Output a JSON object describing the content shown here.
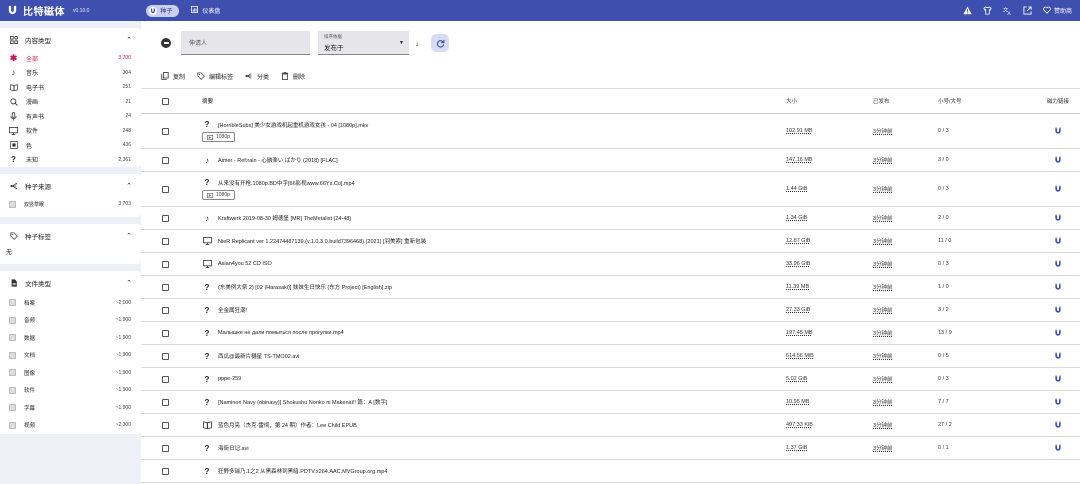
{
  "app": {
    "title": "比特磁体",
    "version": "v0.10.0"
  },
  "nav": {
    "torrents_tab": "种子",
    "dashboard_tab": "仪表盘",
    "donate": "赞助商"
  },
  "colors": {
    "primary": "#3f4fb0",
    "active": "#c2185b"
  },
  "sidebar": {
    "content_type": {
      "title": "内容类型",
      "items": [
        {
          "label": "全部",
          "count": "3,700",
          "icon": "asterisk-icon",
          "active": true
        },
        {
          "label": "音乐",
          "count": "304",
          "icon": "music-note-icon"
        },
        {
          "label": "电子书",
          "count": "251",
          "icon": "ebook-icon"
        },
        {
          "label": "漫画",
          "count": "21",
          "icon": "comic-icon"
        },
        {
          "label": "有声书",
          "count": "24",
          "icon": "microphone-icon"
        },
        {
          "label": "软件",
          "count": "248",
          "icon": "monitor-icon"
        },
        {
          "label": "色",
          "count": "436",
          "icon": "xxx-icon"
        },
        {
          "label": "未知",
          "count": "2,361",
          "icon": "question-icon"
        }
      ]
    },
    "torrent_source": {
      "title": "种子来源",
      "items": [
        {
          "label": "双竖草眠",
          "count": "3,703"
        }
      ]
    },
    "torrent_tags": {
      "title": "种子标签",
      "empty_text": "无"
    },
    "file_type": {
      "title": "文件类型",
      "items": [
        {
          "label": "档案",
          "count": "~2,000"
        },
        {
          "label": "音频",
          "count": "~1,900"
        },
        {
          "label": "数据",
          "count": "~1,900"
        },
        {
          "label": "文档",
          "count": "~1,900"
        },
        {
          "label": "图像",
          "count": "~1,900"
        },
        {
          "label": "软件",
          "count": "~1,900"
        },
        {
          "label": "字幕",
          "count": "~1,900"
        },
        {
          "label": "视频",
          "count": "~2,300"
        }
      ]
    }
  },
  "filters": {
    "search_placeholder": "伸请人",
    "sort_label": "排序依据",
    "sort_value": "发布于"
  },
  "toolbar": {
    "copy": "复制",
    "edit_tags": "编辑标签",
    "classify": "分类",
    "delete": "删除"
  },
  "table": {
    "headers": {
      "name": "摘要",
      "size": "大小",
      "published": "已发布",
      "peers": "小号/大号",
      "magnet": "磁力链接"
    },
    "rows": [
      {
        "icon": "question",
        "name": "[HorribleSubs] 美少女游戏机起重机游戏女孩 - 04 [1080p].mkv",
        "tag": "1080p",
        "size": "102.91 MB",
        "published": "3分钟前",
        "peers": "0 / 3"
      },
      {
        "icon": "music",
        "name": "Aimer - Ref:rain - 心融楽い ばかり (2018) [FLAC]",
        "tag": "",
        "size": "147.16 MB",
        "published": "3分钟前",
        "peers": "3 / 0"
      },
      {
        "icon": "question",
        "name": "从来没有开枪.1080p.BD中字[66影视www.66Ys.Co].mp4",
        "tag": "1080p",
        "size": "1.44 GiB",
        "published": "3分钟前",
        "peers": "0 / 3"
      },
      {
        "icon": "music",
        "name": "Kraftwerk 2019-08-30 姆德堡 [MR] TheMetalist (24-48)",
        "tag": "",
        "size": "1.34 GiB",
        "published": "3分钟前",
        "peers": "2 / 0"
      },
      {
        "icon": "monitor",
        "name": "NieR Replicant ver 1.22474487139.(v.1.0.3.0.build7396468).(2021) [羽美索] 重新包装",
        "tag": "",
        "size": "12.87 GiB",
        "published": "3分钟前",
        "peers": "11 / 0"
      },
      {
        "icon": "monitor",
        "name": "Asian4you 52 CD ISO",
        "tag": "",
        "size": "33.96 GiB",
        "published": "3分钟前",
        "peers": "0 / 3"
      },
      {
        "icon": "question",
        "name": "(东美例大祭 2) [02 (Harasaki)] 妹妹生日快乐 (东方 Project) [English].zip",
        "tag": "",
        "size": "11.39 MB",
        "published": "3分钟前",
        "peers": "1 / 0"
      },
      {
        "icon": "question",
        "name": "全金属狂潮!",
        "tag": "",
        "size": "27.33 GiB",
        "published": "3分钟前",
        "peers": "3 / 2"
      },
      {
        "icon": "question",
        "name": "Малышке не дали помыться после прогулки.mp4",
        "tag": "",
        "size": "197.45 MB",
        "published": "3分钟前",
        "peers": "13 / 9"
      },
      {
        "icon": "question",
        "name": "西瓜@最新片樋星 TS-TMO02.avi",
        "tag": "",
        "size": "614.56 MiB",
        "published": "3分钟前",
        "peers": "0 / 5"
      },
      {
        "icon": "question",
        "name": "pppe-259",
        "tag": "",
        "size": "5.02 GiB",
        "published": "3分钟前",
        "peers": "0 / 3"
      },
      {
        "icon": "question",
        "name": "[Naminori Navy (obinavy)] Shokushu Nonko ni Makenai!! 篇：A [数字]",
        "tag": "",
        "size": "10.95 MB",
        "published": "3分钟前",
        "peers": "7 / 7"
      },
      {
        "icon": "book",
        "name": "蓝色月亮（杰克·雷彻，第 24 期）作者：Lee Child EPUB",
        "tag": "",
        "size": "497.33 KiB",
        "published": "3分钟前",
        "peers": "27 / 2"
      },
      {
        "icon": "question",
        "name": "海街日记.avi",
        "tag": "",
        "size": "1.37 GiB",
        "published": "3分钟前",
        "peers": "0 / 1"
      },
      {
        "icon": "question",
        "name": "狂野多瑞乃.1之2 从黑森林到黑暗.PDTV.x264.AAC.MVGroup.org.mp4",
        "tag": "",
        "size": "",
        "published": "",
        "peers": ""
      }
    ]
  }
}
